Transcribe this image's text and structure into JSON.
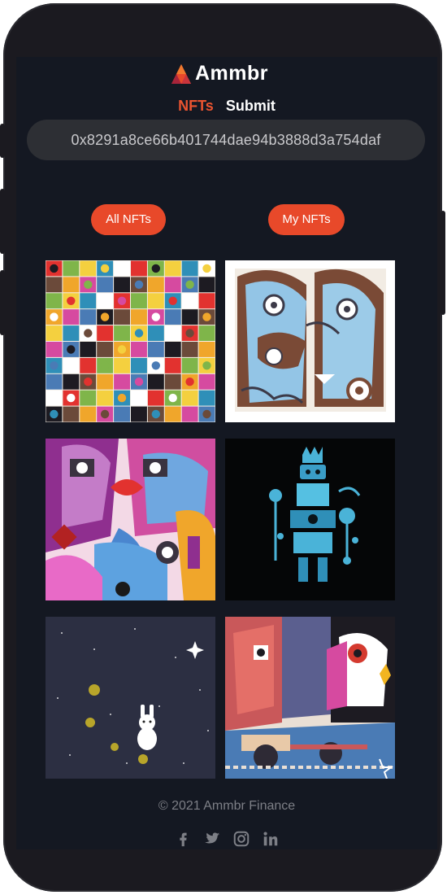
{
  "brand": {
    "name": "Ammbr",
    "accent_color": "#e8492a",
    "background_color": "#141822"
  },
  "nav": {
    "nfts_label": "NFTs",
    "submit_label": "Submit"
  },
  "wallet": {
    "address": "0x8291a8ce66b401744dae94b3888d3a754daf"
  },
  "filters": {
    "all_label": "All NFTs",
    "my_label": "My NFTs"
  },
  "gallery": {
    "items": [
      {
        "icon": "pattern-collage-artwork"
      },
      {
        "icon": "abstract-faces-blue-brown-artwork"
      },
      {
        "icon": "abstract-faces-pink-blue-artwork"
      },
      {
        "icon": "robot-figure-dark-artwork"
      },
      {
        "icon": "moon-rabbit-night-artwork"
      },
      {
        "icon": "cubist-portraits-artwork"
      }
    ]
  },
  "footer": {
    "copyright": "© 2021 Ammbr Finance",
    "social": [
      "facebook-icon",
      "twitter-icon",
      "instagram-icon",
      "linkedin-icon"
    ]
  }
}
